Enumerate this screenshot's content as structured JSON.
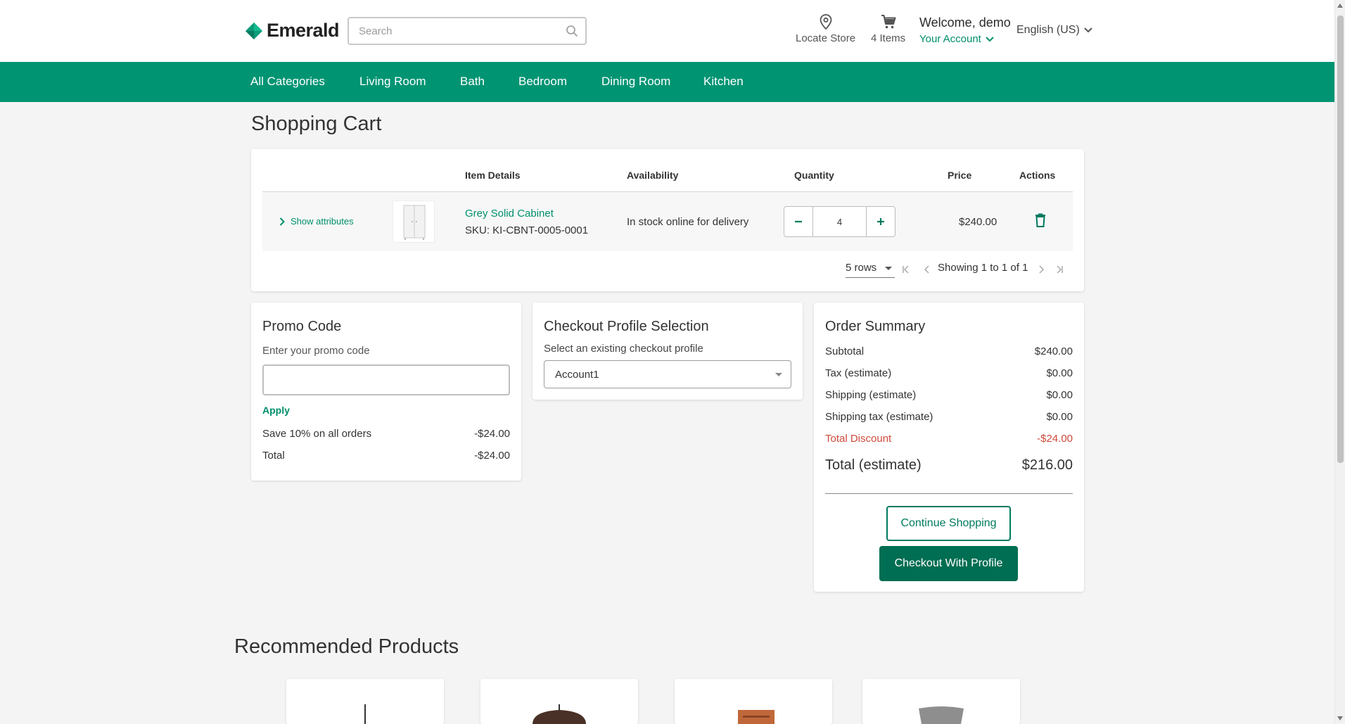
{
  "header": {
    "brand": "Emerald",
    "search_placeholder": "Search",
    "locate_store": "Locate Store",
    "cart_items": "4 Items",
    "welcome": "Welcome, demo",
    "your_account": "Your Account",
    "language": "English (US)"
  },
  "nav": {
    "items": [
      "All Categories",
      "Living Room",
      "Bath",
      "Bedroom",
      "Dining Room",
      "Kitchen"
    ]
  },
  "page_title": "Shopping Cart",
  "cart": {
    "columns": [
      "Item Details",
      "Availability",
      "Quantity",
      "Price",
      "Actions"
    ],
    "show_attributes": "Show attributes",
    "items": [
      {
        "name": "Grey Solid Cabinet",
        "sku": "SKU: KI-CBNT-0005-0001",
        "availability": "In stock online for delivery",
        "quantity": "4",
        "price": "$240.00"
      }
    ],
    "rows_per_page": "5 rows",
    "showing": "Showing 1 to 1 of 1"
  },
  "promo": {
    "title": "Promo Code",
    "label": "Enter your promo code",
    "input_value": "",
    "apply": "Apply",
    "lines": [
      {
        "label": "Save 10% on all orders",
        "value": "-$24.00"
      },
      {
        "label": "Total",
        "value": "-$24.00"
      }
    ]
  },
  "profile": {
    "title": "Checkout Profile Selection",
    "label": "Select an existing checkout profile",
    "selected": "Account1"
  },
  "summary": {
    "title": "Order Summary",
    "lines": [
      {
        "label": "Subtotal",
        "value": "$240.00"
      },
      {
        "label": "Tax (estimate)",
        "value": "$0.00"
      },
      {
        "label": "Shipping (estimate)",
        "value": "$0.00"
      },
      {
        "label": "Shipping tax (estimate)",
        "value": "$0.00"
      },
      {
        "label": "Total Discount",
        "value": "-$24.00"
      }
    ],
    "total_label": "Total (estimate)",
    "total_value": "$216.00",
    "continue_shopping": "Continue Shopping",
    "checkout": "Checkout With Profile"
  },
  "recommended_title": "Recommended Products",
  "colors": {
    "brand_green": "#009473",
    "link_green": "#008f6c",
    "button_green": "#006e52",
    "discount_red": "#cf4a3a"
  }
}
